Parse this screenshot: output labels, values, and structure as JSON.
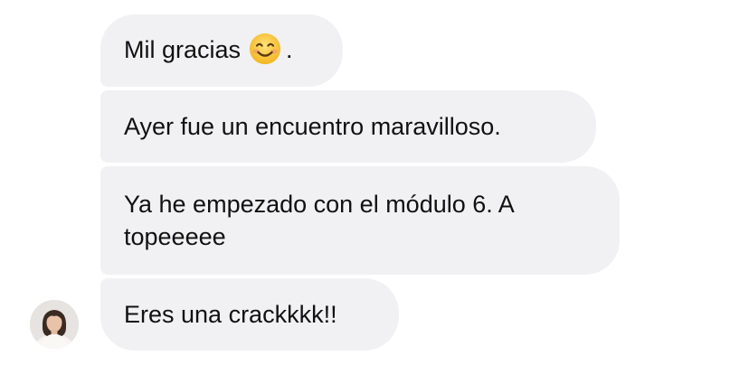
{
  "messages": [
    {
      "text_before": "Mil gracias",
      "emoji": "smiling-face-icon",
      "text_after": "."
    },
    {
      "text": "Ayer fue un encuentro maravilloso."
    },
    {
      "text": "Ya he empezado con el módulo 6. A topeeeee"
    },
    {
      "text": "Eres una crackkkk!!"
    }
  ],
  "sender": {
    "avatar_icon": "profile-photo"
  },
  "colors": {
    "bubble_bg": "#f1f1f3",
    "text": "#111111",
    "emoji_face": "#f7c43a"
  }
}
